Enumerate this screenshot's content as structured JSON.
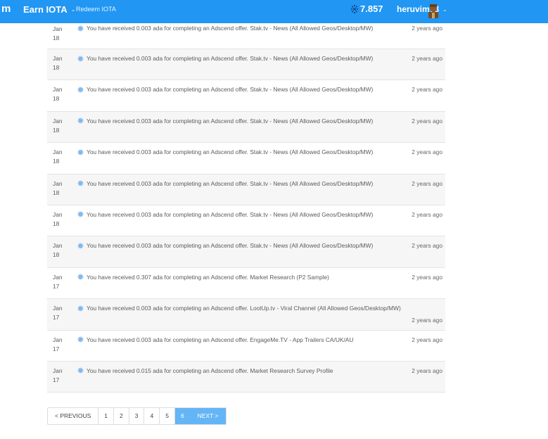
{
  "header": {
    "brand_fragment": "m",
    "earn_menu_label": "Earn IOTA",
    "redeem_link_label": "Redeem IOTA",
    "balance": "7.857",
    "username": "heruvim78",
    "colors": {
      "bar": "#2196f3",
      "text": "#ffffff"
    },
    "icons": {
      "balance": "iota-coin-icon",
      "dropdown": "chevron-down-icon",
      "avatar": "user-avatar"
    }
  },
  "activity": {
    "rows": [
      {
        "month": "Jan",
        "day": "18",
        "message": "You have received 0.003 ada for completing an Adscend offer. Stak.tv - News (All Allowed Geos/Desktop/MW)",
        "time": "2 years ago"
      },
      {
        "month": "Jan",
        "day": "18",
        "message": "You have received 0.003 ada for completing an Adscend offer. Stak.tv - News (All Allowed Geos/Desktop/MW)",
        "time": "2 years ago"
      },
      {
        "month": "Jan",
        "day": "18",
        "message": "You have received 0.003 ada for completing an Adscend offer. Stak.tv - News (All Allowed Geos/Desktop/MW)",
        "time": "2 years ago"
      },
      {
        "month": "Jan",
        "day": "18",
        "message": "You have received 0.003 ada for completing an Adscend offer. Stak.tv - News (All Allowed Geos/Desktop/MW)",
        "time": "2 years ago"
      },
      {
        "month": "Jan",
        "day": "18",
        "message": "You have received 0.003 ada for completing an Adscend offer. Stak.tv - News (All Allowed Geos/Desktop/MW)",
        "time": "2 years ago"
      },
      {
        "month": "Jan",
        "day": "18",
        "message": "You have received 0.003 ada for completing an Adscend offer. Stak.tv - News (All Allowed Geos/Desktop/MW)",
        "time": "2 years ago"
      },
      {
        "month": "Jan",
        "day": "18",
        "message": "You have received 0.003 ada for completing an Adscend offer. Stak.tv - News (All Allowed Geos/Desktop/MW)",
        "time": "2 years ago"
      },
      {
        "month": "Jan",
        "day": "18",
        "message": "You have received 0.003 ada for completing an Adscend offer. Stak.tv - News (All Allowed Geos/Desktop/MW)",
        "time": "2 years ago"
      },
      {
        "month": "Jan",
        "day": "17",
        "message": "You have received 0.307 ada for completing an Adscend offer. Market Research (P2 Sample)",
        "time": "2 years ago"
      },
      {
        "month": "Jan",
        "day": "17",
        "message": "You have received 0.003 ada for completing an Adscend offer. LootUp.tv - Viral Channel (All Allowed Geos/Desktop/MW)",
        "time": "2 years ago"
      },
      {
        "month": "Jan",
        "day": "17",
        "message": "You have received 0.003 ada for completing an Adscend offer. EngageMe.TV - App Trailers CA/UK/AU",
        "time": "2 years ago"
      },
      {
        "month": "Jan",
        "day": "17",
        "message": "You have received 0.015 ada for completing an Adscend offer. Market Research Survey Profile",
        "time": "2 years ago"
      }
    ],
    "row_icon": "cardano-gear-icon"
  },
  "pagination": {
    "prev_label": "< PREVIOUS",
    "pages": [
      "1",
      "2",
      "3",
      "4",
      "5",
      "6"
    ],
    "current_page": "6",
    "next_label": "NEXT >",
    "colors": {
      "active": "#64b5f6"
    }
  }
}
